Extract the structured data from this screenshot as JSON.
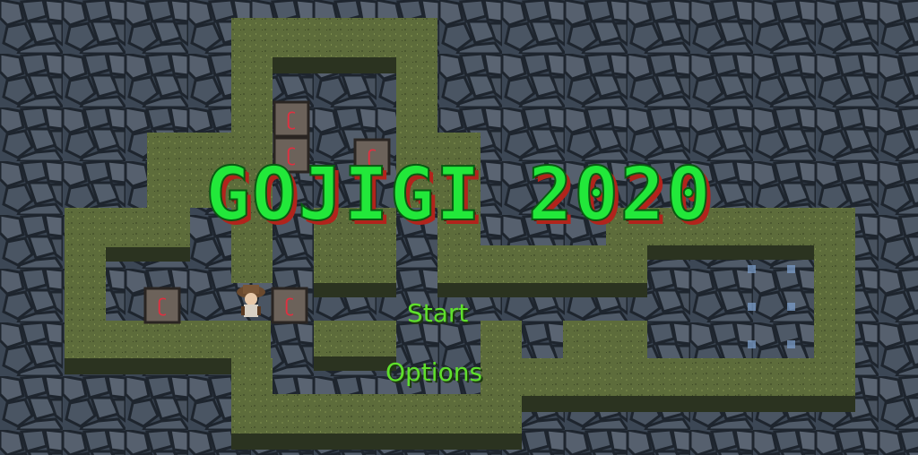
{
  "game": {
    "title": "GOJIGI 2020"
  },
  "menu": {
    "start_label": "Start",
    "options_label": "Options"
  },
  "colors": {
    "title_fill": "#22e83a",
    "title_shadow": "#b1241c",
    "menu_text": "#5fe02c",
    "stone_bg": "#3a4552",
    "grass_top": "#5c6b3a",
    "wall_side": "#2f3620"
  },
  "sprites": {
    "player": "player-character",
    "crate_icon": "crate-with-key-glyph",
    "goal": "goal-marker"
  }
}
